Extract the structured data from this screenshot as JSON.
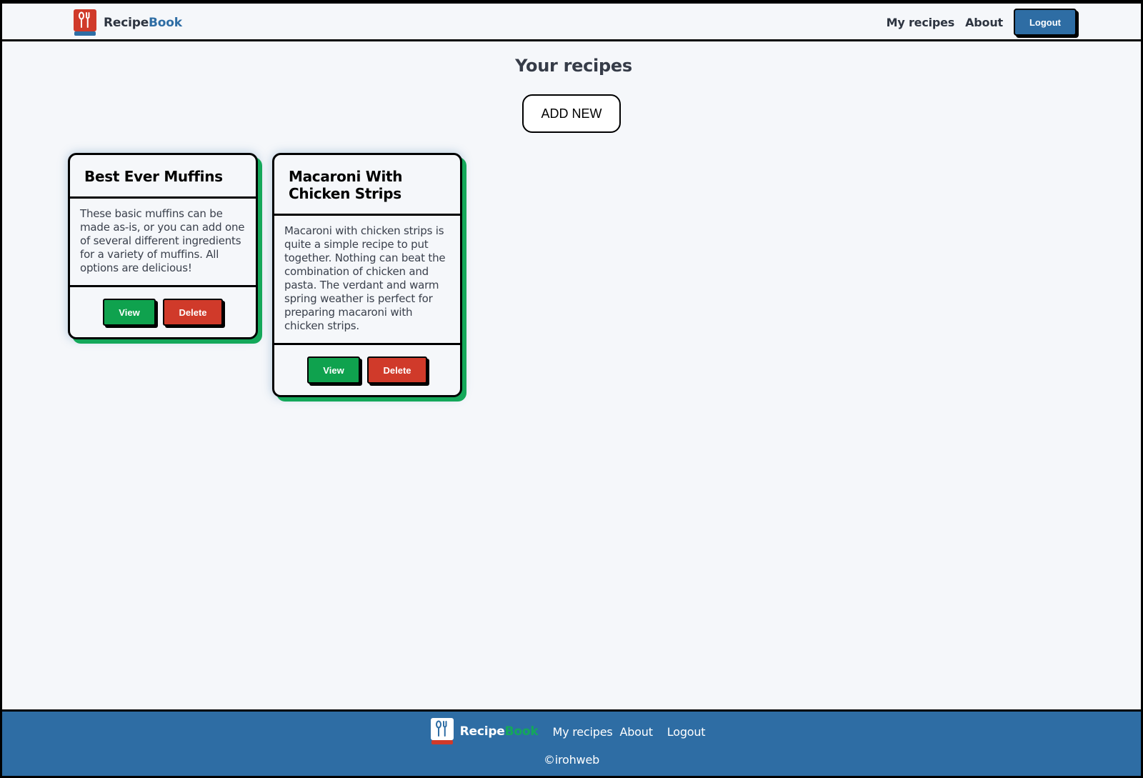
{
  "header": {
    "logo_text_main": "Recipe",
    "logo_text_accent": "Book",
    "logo_icon": "fork-spoon-book-icon",
    "nav": {
      "my_recipes": "My recipes",
      "about": "About",
      "logout": "Logout"
    }
  },
  "main": {
    "title": "Your recipes",
    "add_label": "ADD NEW",
    "recipes": [
      {
        "title": "Best Ever Muffins",
        "description": "These basic muffins can be made as-is, or you can add one of several different ingredients for a variety of muffins. All options are delicious!",
        "view_label": "View",
        "delete_label": "Delete"
      },
      {
        "title": "Macaroni With Chicken Strips",
        "description": "Macaroni with chicken strips is quite a simple recipe to put together. Nothing can beat the combination of chicken and pasta. The verdant and warm spring weather is perfect for preparing macaroni with chicken strips.",
        "view_label": "View",
        "delete_label": "Delete"
      }
    ]
  },
  "footer": {
    "logo_text_main": "Recipe",
    "logo_text_accent": "Book",
    "links": {
      "my_recipes": "My recipes",
      "about": "About",
      "logout": "Logout"
    },
    "copyright": "©irohweb"
  },
  "colors": {
    "primary_blue": "#2e6da4",
    "green": "#0fa24e",
    "red": "#d03a2a",
    "background": "#f5f7fa"
  }
}
